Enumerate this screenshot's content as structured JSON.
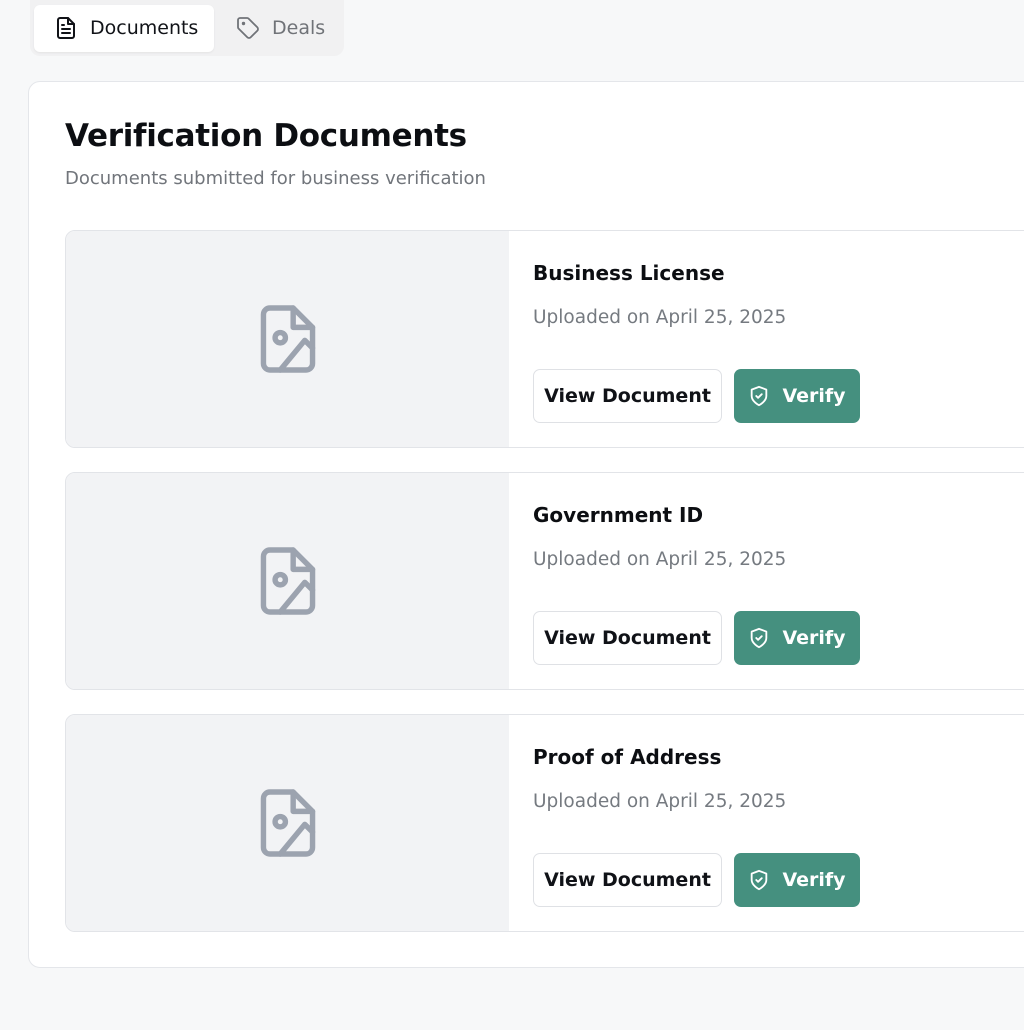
{
  "tabs": [
    {
      "label": "Documents",
      "icon": "file-text-icon",
      "active": true
    },
    {
      "label": "Deals",
      "icon": "tag-icon",
      "active": false
    }
  ],
  "panel": {
    "title": "Verification Documents",
    "subtitle": "Documents submitted for business verification"
  },
  "documents": [
    {
      "name": "Business License",
      "uploaded": "Uploaded on April 25, 2025",
      "thumbnail_icon": "file-image-icon"
    },
    {
      "name": "Government ID",
      "uploaded": "Uploaded on April 25, 2025",
      "thumbnail_icon": "file-image-icon"
    },
    {
      "name": "Proof of Address",
      "uploaded": "Uploaded on April 25, 2025",
      "thumbnail_icon": "file-image-icon"
    }
  ],
  "buttons": {
    "view_label": "View Document",
    "verify_label": "Verify",
    "verify_icon": "shield-check-icon"
  },
  "colors": {
    "verify_button": "#45907f",
    "thumbnail_bg": "#f2f3f5",
    "icon_gray": "#9ca3af"
  }
}
